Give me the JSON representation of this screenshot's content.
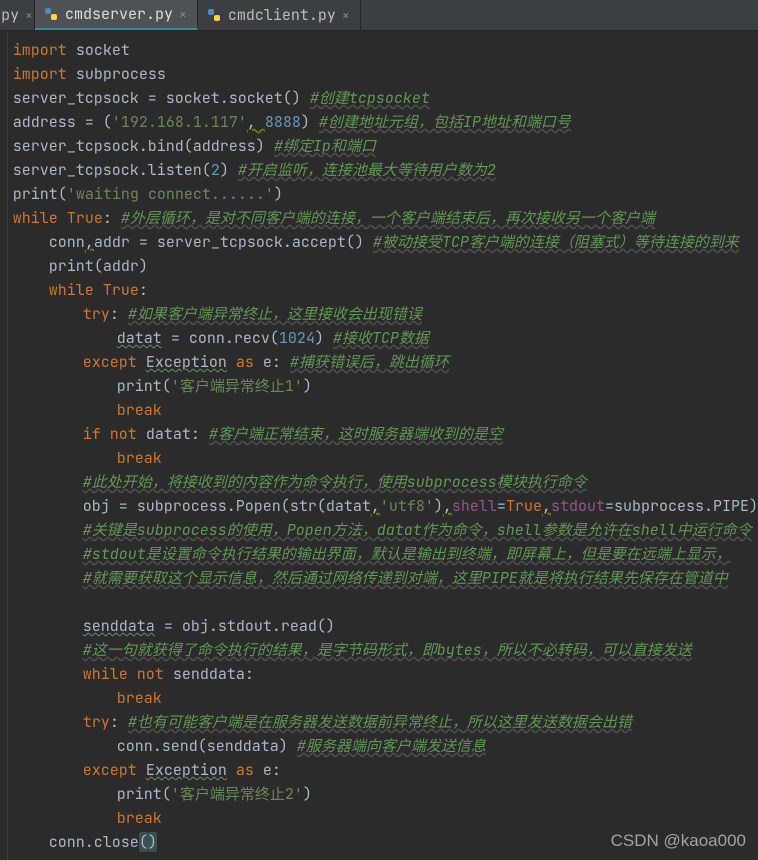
{
  "tabs": {
    "collapsed_label": "py",
    "t1_label": "cmdserver.py",
    "t2_label": "cmdclient.py"
  },
  "code": {
    "l1_a": "import",
    "l1_b": " socket",
    "l2_a": "import",
    "l2_b": " subprocess",
    "l3_a": "server_tcpsock = socket.socket()    ",
    "l3_c": "#创建tcpsocket",
    "l4_a": "address = (",
    "l4_b": "'192.168.1.117'",
    "l4_c": ", ",
    "l4_d": "8888",
    "l4_e": ")       ",
    "l4_f": "#创建地址元组，包括IP地址和端口号",
    "l5_a": "server_tcpsock.bind(address)     ",
    "l5_c": "#绑定Ip和端口",
    "l6_a": "server_tcpsock.listen(",
    "l6_b": "2",
    "l6_c": ")        ",
    "l6_d": "#开启监听，连接池最大等待用户数为2",
    "l7_a": "print",
    "l7_b": "(",
    "l7_c": "'waiting connect......'",
    "l7_d": ")",
    "l8_a": "while ",
    "l8_b": "True",
    "l8_c": ":     ",
    "l8_d": "#外层循环，是对不同客户端的连接，一个客户端结束后，再次接收另一个客户端",
    "l9_a": "conn",
    "l9_b": ",",
    "l9_c": "addr = server_tcpsock.accept()   ",
    "l9_d": "#被动接受TCP客户端的连接（阻塞式）等待连接的到来",
    "l10_a": "print",
    "l10_b": "(addr)",
    "l11_a": "while ",
    "l11_b": "True",
    "l11_c": ":",
    "l12_a": "try",
    "l12_b": ":     ",
    "l12_c": "#如果客户端异常终止，这里接收会出现错误",
    "l13_a": "datat",
    "l13_b": " = conn.recv(",
    "l13_c": "1024",
    "l13_d": ")        ",
    "l13_e": "#接收TCP数据",
    "l14_a": "except ",
    "l14_b": "Exception",
    "l14_c": " as ",
    "l14_d": "e:   ",
    "l14_e": "#捕获错误后，跳出循环",
    "l15_a": "print",
    "l15_b": "(",
    "l15_c": "'客户端异常终止1'",
    "l15_d": ")",
    "l16_a": "break",
    "l17_a": "if not ",
    "l17_b": "datat:        ",
    "l17_c": "#客户端正常结束，这时服务器端收到的是空",
    "l18_a": "break",
    "l19_a": "#此处开始，将接收到的内容作为命令执行，使用subprocess模块执行命令",
    "l20_a": "obj = subprocess.Popen(",
    "l20_b": "str",
    "l20_c": "(datat",
    "l20_c2": ",",
    "l20_d": "'utf8'",
    "l20_e": ")",
    "l20_e2": ",",
    "l20_f": "shell",
    "l20_g": "=",
    "l20_h": "True",
    "l20_h2": ",",
    "l20_i": "stdout",
    "l20_j": "=subprocess.PIPE)",
    "l21_a": "#关键是subprocess的使用，Popen方法，datat作为命令，shell参数是允许在shell中运行命令",
    "l22_a": "#stdout是设置命令执行结果的输出界面，默认是输出到终端，即屏幕上，但是要在远端上显示，",
    "l23_a": "#就需要获取这个显示信息，然后通过网络传递到对端，这里PIPE就是将执行结果先保存在管道中",
    "l25_a": "senddata",
    "l25_b": " = obj.stdout.read()",
    "l26_a": "#这一句就获得了命令执行的结果，是字节码形式，即bytes，所以不必转码，可以直接发送",
    "l27_a": "while not ",
    "l27_b": "senddata:",
    "l28_a": "break",
    "l29_a": "try",
    "l29_b": ":     ",
    "l29_c": "#也有可能客户端是在服务器发送数据前异常终止，所以这里发送数据会出错",
    "l30_a": "conn.send(senddata)     ",
    "l30_b": "#服务器端向客户端发送信息",
    "l31_a": "except ",
    "l31_b": "Exception",
    "l31_c": " as ",
    "l31_d": "e:",
    "l32_a": "print",
    "l32_b": "(",
    "l32_c": "'客户端异常终止2'",
    "l32_d": ")",
    "l33_a": "break",
    "l34_a": "conn.close",
    "l34_b": "(",
    "l34_c": ")"
  },
  "watermark": "CSDN @kaoa000"
}
